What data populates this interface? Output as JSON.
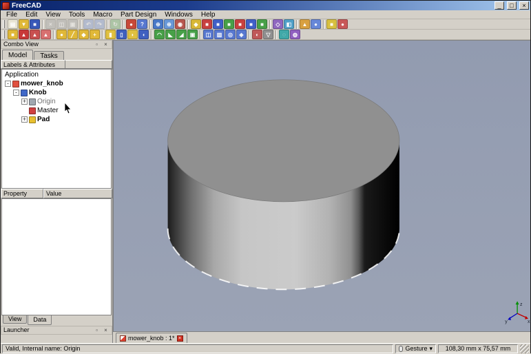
{
  "window": {
    "title": "FreeCAD",
    "minimize_glyph": "_",
    "maximize_glyph": "□",
    "close_glyph": "×"
  },
  "dock": {
    "pin_glyph": "▫",
    "close_glyph": "×"
  },
  "menu": {
    "items": [
      {
        "name": "menu-file",
        "label": "File"
      },
      {
        "name": "menu-edit",
        "label": "Edit"
      },
      {
        "name": "menu-view",
        "label": "View"
      },
      {
        "name": "menu-tools",
        "label": "Tools"
      },
      {
        "name": "menu-macro",
        "label": "Macro"
      },
      {
        "name": "menu-part-design",
        "label": "Part Design"
      },
      {
        "name": "menu-windows",
        "label": "Windows"
      },
      {
        "name": "menu-help",
        "label": "Help"
      }
    ]
  },
  "toolbar1": {
    "icons": [
      {
        "name": "new-document-button",
        "g": "▤",
        "c": "#e8e4d4"
      },
      {
        "name": "open-document-button",
        "g": "▼",
        "c": "#e0b838"
      },
      {
        "name": "save-document-button",
        "g": "■",
        "c": "#3858b8"
      },
      {
        "name": "toolbar-separator",
        "sep": true
      },
      {
        "name": "cut-button",
        "g": "×",
        "c": "#a8a8a8",
        "disabled": true
      },
      {
        "name": "copy-button",
        "g": "◫",
        "c": "#a8a8a8",
        "disabled": true
      },
      {
        "name": "paste-button",
        "g": "▣",
        "c": "#a8a8a8",
        "disabled": true
      },
      {
        "name": "toolbar-separator",
        "sep": true
      },
      {
        "name": "undo-button",
        "g": "↶",
        "c": "#88a0d8",
        "disabled": true
      },
      {
        "name": "redo-button",
        "g": "↷",
        "c": "#88a0d8",
        "disabled": true
      },
      {
        "name": "toolbar-separator",
        "sep": true
      },
      {
        "name": "refresh-button",
        "g": "↻",
        "c": "#78b878",
        "disabled": true
      },
      {
        "name": "toolbar-separator",
        "sep": true
      },
      {
        "name": "macro-record-button",
        "g": "●",
        "c": "#c84838"
      },
      {
        "name": "whats-this-button",
        "g": "?",
        "c": "#5878d0"
      },
      {
        "name": "toolbar-separator",
        "sep": true
      },
      {
        "name": "fit-all-button",
        "g": "⊕",
        "c": "#4878c8"
      },
      {
        "name": "zoom-selection-button",
        "g": "⊕",
        "c": "#6898d8"
      },
      {
        "name": "draw-style-button",
        "g": "◉",
        "c": "#b85850"
      },
      {
        "name": "toolbar-separator",
        "sep": true
      },
      {
        "name": "view-isometric-button",
        "g": "◆",
        "c": "#d8b838"
      },
      {
        "name": "view-front-button",
        "g": "■",
        "c": "#c84040"
      },
      {
        "name": "view-top-button",
        "g": "■",
        "c": "#4060c8"
      },
      {
        "name": "view-right-button",
        "g": "■",
        "c": "#48a048"
      },
      {
        "name": "view-rear-button",
        "g": "■",
        "c": "#c84040"
      },
      {
        "name": "view-bottom-button",
        "g": "■",
        "c": "#4060c8"
      },
      {
        "name": "view-left-button",
        "g": "■",
        "c": "#48a048"
      },
      {
        "name": "toolbar-separator",
        "sep": true
      },
      {
        "name": "measure-distance-button",
        "g": "◇",
        "c": "#9068c0"
      },
      {
        "name": "clipping-plane-button",
        "g": "◧",
        "c": "#50a0c8"
      },
      {
        "name": "toolbar-separator",
        "sep": true
      },
      {
        "name": "texture-button",
        "g": "▲",
        "c": "#d8a040"
      },
      {
        "name": "appearance-button",
        "g": "●",
        "c": "#6888d8"
      },
      {
        "name": "toolbar-separator",
        "sep": true
      },
      {
        "name": "part-box-button",
        "g": "■",
        "c": "#d8c040"
      },
      {
        "name": "part-cylinder-button",
        "g": "●",
        "c": "#c85858"
      }
    ]
  },
  "toolbar2": {
    "icons": [
      {
        "name": "create-body-button",
        "g": "■",
        "c": "#e0b838"
      },
      {
        "name": "create-sketch-button",
        "g": "▲",
        "c": "#c83838"
      },
      {
        "name": "edit-sketch-button",
        "g": "▲",
        "c": "#c85050"
      },
      {
        "name": "map-sketch-button",
        "g": "▲",
        "c": "#d87070"
      },
      {
        "name": "toolbar-separator",
        "sep": true
      },
      {
        "name": "datum-point-button",
        "g": "●",
        "c": "#e0b838"
      },
      {
        "name": "datum-line-button",
        "g": "╱",
        "c": "#e0b838"
      },
      {
        "name": "datum-plane-button",
        "g": "◆",
        "c": "#e0b838"
      },
      {
        "name": "local-cs-button",
        "g": "+",
        "c": "#e0b838"
      },
      {
        "name": "toolbar-separator",
        "sep": true
      },
      {
        "name": "pad-button",
        "g": "▮",
        "c": "#e0c040"
      },
      {
        "name": "pocket-button",
        "g": "▯",
        "c": "#4060c0"
      },
      {
        "name": "revolution-button",
        "g": "◗",
        "c": "#e0c040"
      },
      {
        "name": "groove-button",
        "g": "◖",
        "c": "#4060c0"
      },
      {
        "name": "toolbar-separator",
        "sep": true
      },
      {
        "name": "fillet-button",
        "g": "◠",
        "c": "#48a048"
      },
      {
        "name": "chamfer-button",
        "g": "◣",
        "c": "#48a048"
      },
      {
        "name": "draft-button",
        "g": "◢",
        "c": "#48a048"
      },
      {
        "name": "thickness-button",
        "g": "▣",
        "c": "#48a048"
      },
      {
        "name": "toolbar-separator",
        "sep": true
      },
      {
        "name": "mirrored-button",
        "g": "◫",
        "c": "#5878d0"
      },
      {
        "name": "linear-pattern-button",
        "g": "▥",
        "c": "#5878d0"
      },
      {
        "name": "polar-pattern-button",
        "g": "◎",
        "c": "#5878d0"
      },
      {
        "name": "multitransform-button",
        "g": "◈",
        "c": "#5878d0"
      },
      {
        "name": "toolbar-separator",
        "sep": true
      },
      {
        "name": "boolean-button",
        "g": "◐",
        "c": "#c05858"
      },
      {
        "name": "migrate-button",
        "g": "▽",
        "c": "#909090"
      },
      {
        "name": "toolbar-separator",
        "sep": true
      },
      {
        "name": "shapebinder-button",
        "g": "◌",
        "c": "#40a8a8"
      },
      {
        "name": "clone-button",
        "g": "◍",
        "c": "#9060c0"
      }
    ]
  },
  "combo": {
    "title": "Combo View",
    "tabs": [
      {
        "name": "tab-model",
        "label": "Model",
        "active": true
      },
      {
        "name": "tab-tasks",
        "label": "Tasks"
      }
    ],
    "header": "Labels & Attributes",
    "tree": [
      {
        "name": "tree-item-application",
        "label": "Application",
        "indent": 0,
        "exp": "",
        "root": true
      },
      {
        "name": "tree-item-mower-knob",
        "label": "mower_knob",
        "indent": 0,
        "exp": "-",
        "c": "#e05040",
        "bold": true
      },
      {
        "name": "tree-item-knob",
        "label": "Knob",
        "indent": 1,
        "exp": "-",
        "c": "#4068c8",
        "bold": true
      },
      {
        "name": "tree-item-origin",
        "label": "Origin",
        "indent": 2,
        "exp": "+",
        "c": "#a0a8b0",
        "gray": true
      },
      {
        "name": "tree-item-master",
        "label": "Master",
        "indent": 2,
        "exp": "",
        "c": "#d04040"
      },
      {
        "name": "tree-item-pad",
        "label": "Pad",
        "indent": 2,
        "exp": "+",
        "c": "#e8c030",
        "bold": true
      }
    ]
  },
  "properties": {
    "columns": [
      {
        "name": "property-column-header",
        "label": "Property"
      },
      {
        "name": "value-column-header",
        "label": "Value"
      }
    ]
  },
  "side_tabs": [
    {
      "name": "tab-view",
      "label": "View"
    },
    {
      "name": "tab-data",
      "label": "Data",
      "active": true
    }
  ],
  "launcher": {
    "title": "Launcher"
  },
  "doc_tab": {
    "label": "mower_knob : 1*"
  },
  "viewport": {
    "bg_top": "#929BB0",
    "bg_bottom": "#9BA3B5",
    "cyl_top": "#909090",
    "axis": {
      "x": "x",
      "y": "y",
      "z": "z"
    }
  },
  "statusbar": {
    "message": "Valid, Internal name: Origin",
    "gesture": "Gesture",
    "dropdown_glyph": "▾",
    "dimensions": "108,30 mm x 75,57 mm"
  }
}
